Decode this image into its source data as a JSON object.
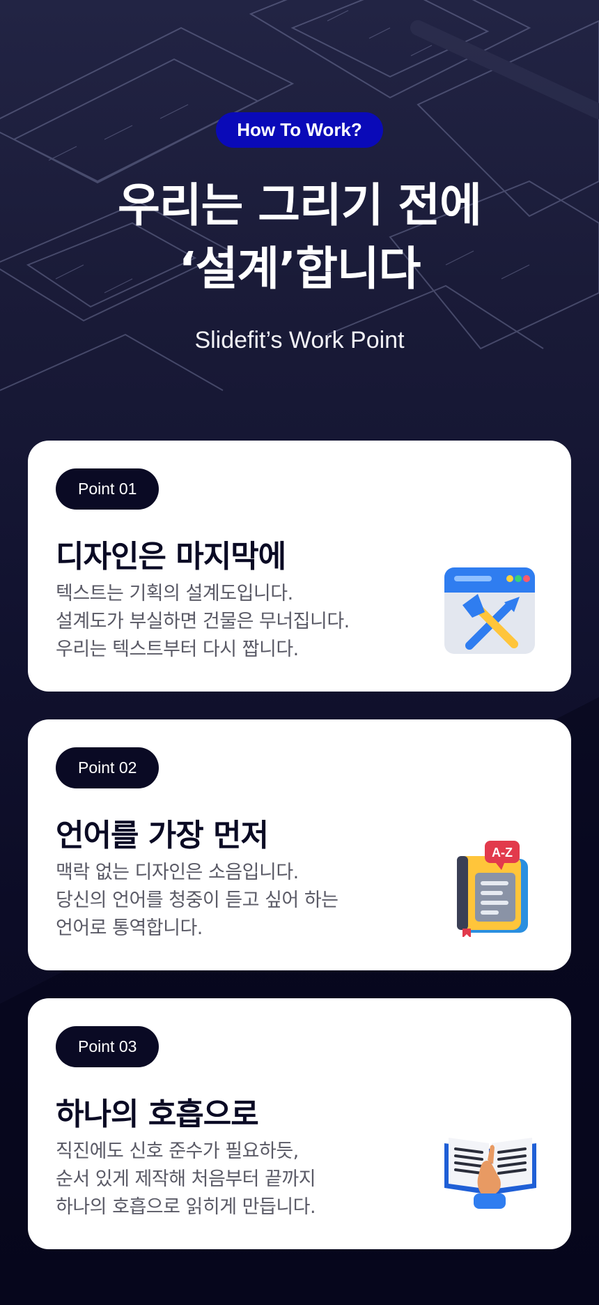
{
  "hero": {
    "badge": "How To Work?",
    "headline_line1": "우리는 그리기 전에",
    "headline_line2": "‘설계’합니다",
    "subtitle": "Slidefit’s Work Point"
  },
  "points": [
    {
      "badge": "Point 01",
      "title": "디자인은 마지막에",
      "lines": [
        "텍스트는 기획의 설계도입니다.",
        "설계도가 부실하면 건물은 무너집니다.",
        "우리는 텍스트부터 다시 짭니다."
      ],
      "icon": "design-tools-icon"
    },
    {
      "badge": "Point 02",
      "title": "언어를 가장 먼저",
      "lines": [
        "맥락 없는 디자인은 소음입니다.",
        "당신의 언어를 청중이 듣고 싶어 하는",
        "언어로 통역합니다."
      ],
      "icon": "dictionary-book-icon",
      "icon_label": "A-Z"
    },
    {
      "badge": "Point 03",
      "title": "하나의 호흡으로",
      "lines": [
        "직진에도 신호 준수가 필요하듯,",
        "순서 있게 제작해 처음부터 끝까지",
        "하나의 호흡으로 읽히게 만듭니다."
      ],
      "icon": "open-book-reading-icon"
    }
  ],
  "colors": {
    "badge_blue": "#0a0ab8",
    "dark_navy": "#0a0a24",
    "card_bg": "#ffffff",
    "body_text": "#5a5a66"
  }
}
